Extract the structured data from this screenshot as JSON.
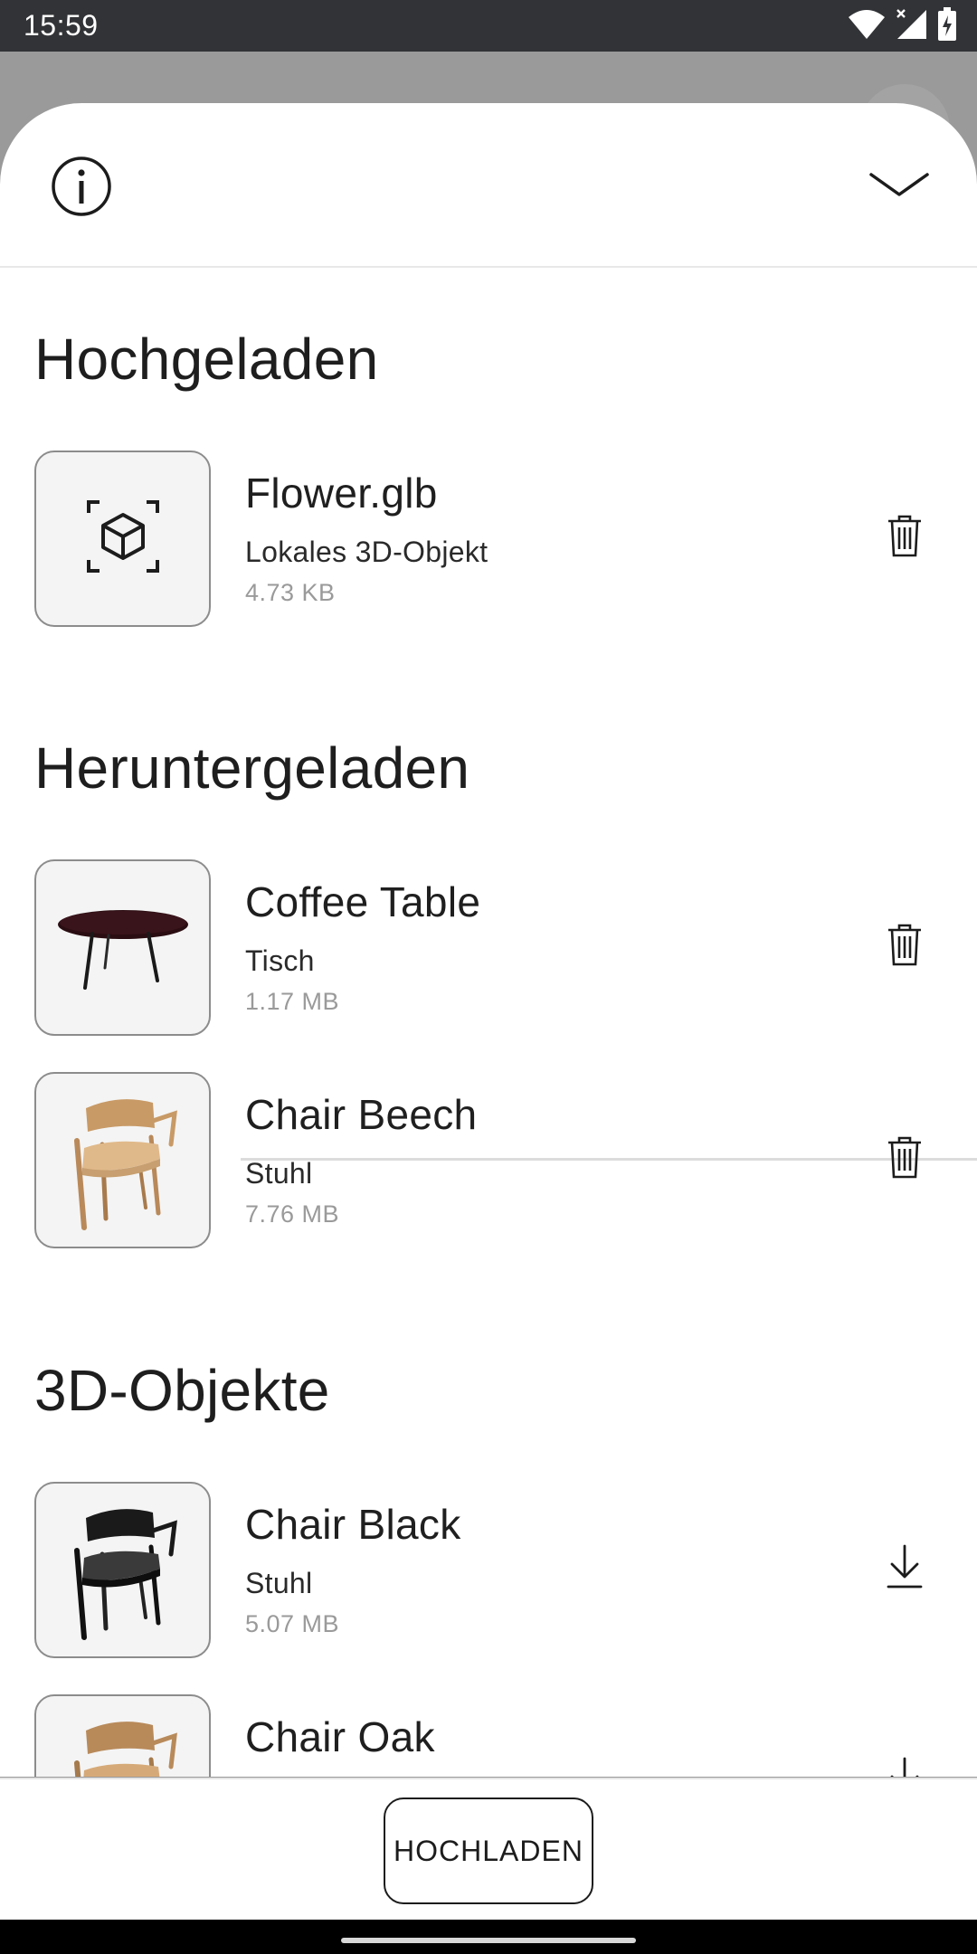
{
  "status_bar": {
    "time": "15:59",
    "icons": [
      "wifi-icon",
      "signal-icon",
      "battery-icon"
    ]
  },
  "sheet": {
    "info_icon": "info-icon",
    "collapse_icon": "chevron-down-icon"
  },
  "sections": {
    "uploaded": {
      "title": "Hochgeladen",
      "items": [
        {
          "title": "Flower.glb",
          "subtitle": "Lokales 3D-Objekt",
          "size": "4.73 KB",
          "thumbnail": "3d-object-placeholder-icon",
          "action_icon": "trash-icon"
        }
      ]
    },
    "downloaded": {
      "title": "Heruntergeladen",
      "items": [
        {
          "title": "Coffee Table",
          "subtitle": "Tisch",
          "size": "1.17 MB",
          "thumbnail": "coffee-table-thumbnail",
          "action_icon": "trash-icon"
        },
        {
          "title": "Chair Beech",
          "subtitle": "Stuhl",
          "size": "7.76 MB",
          "thumbnail": "chair-beech-thumbnail",
          "action_icon": "trash-icon"
        }
      ]
    },
    "objects": {
      "title": "3D-Objekte",
      "items": [
        {
          "title": "Chair Black",
          "subtitle": "Stuhl",
          "size": "5.07 MB",
          "thumbnail": "chair-black-thumbnail",
          "action_icon": "download-icon"
        },
        {
          "title": "Chair Oak",
          "thumbnail": "chair-oak-thumbnail",
          "action_icon": "download-icon"
        }
      ]
    }
  },
  "footer": {
    "upload_label": "HOCHLADEN"
  },
  "colors": {
    "sheet_background": "#ffffff",
    "scrim": "#9a9a9a",
    "status_bar": "#323336",
    "secondary_text": "#9a9a9a"
  }
}
